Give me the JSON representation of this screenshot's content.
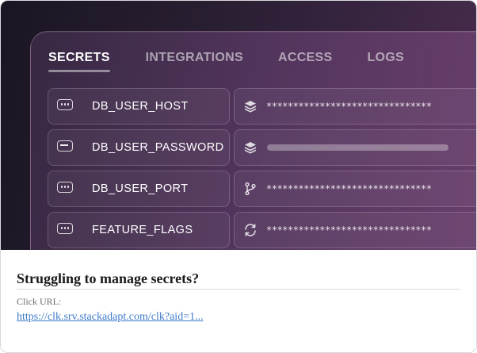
{
  "tabs": [
    "SECRETS",
    "INTEGRATIONS",
    "ACCESS",
    "LOGS"
  ],
  "active_tab": "SECRETS",
  "secrets": [
    {
      "key": "DB_USER_HOST",
      "key_icon": "dots-field-icon",
      "value_icon": "layers-icon",
      "value": "*******************************",
      "loading": false
    },
    {
      "key": "DB_USER_PASSWORD",
      "key_icon": "minus-field-icon",
      "value_icon": "layers-icon",
      "value": "",
      "loading": true
    },
    {
      "key": "DB_USER_PORT",
      "key_icon": "dots-field-icon",
      "value_icon": "git-branch-icon",
      "value": "*******************************",
      "loading": false
    },
    {
      "key": "FEATURE_FLAGS",
      "key_icon": "dots-field-icon",
      "value_icon": "refresh-icon",
      "value": "*******************************",
      "loading": false
    }
  ],
  "ad": {
    "headline": "Struggling to manage secrets?",
    "click_label": "Click URL:",
    "click_url": "https://clk.srv.stackadapt.com/clk?aid=1..."
  },
  "colors": {
    "hero_dark": "#1b1623",
    "hero_purple": "#4a2c4e",
    "link": "#3d7ac9"
  }
}
